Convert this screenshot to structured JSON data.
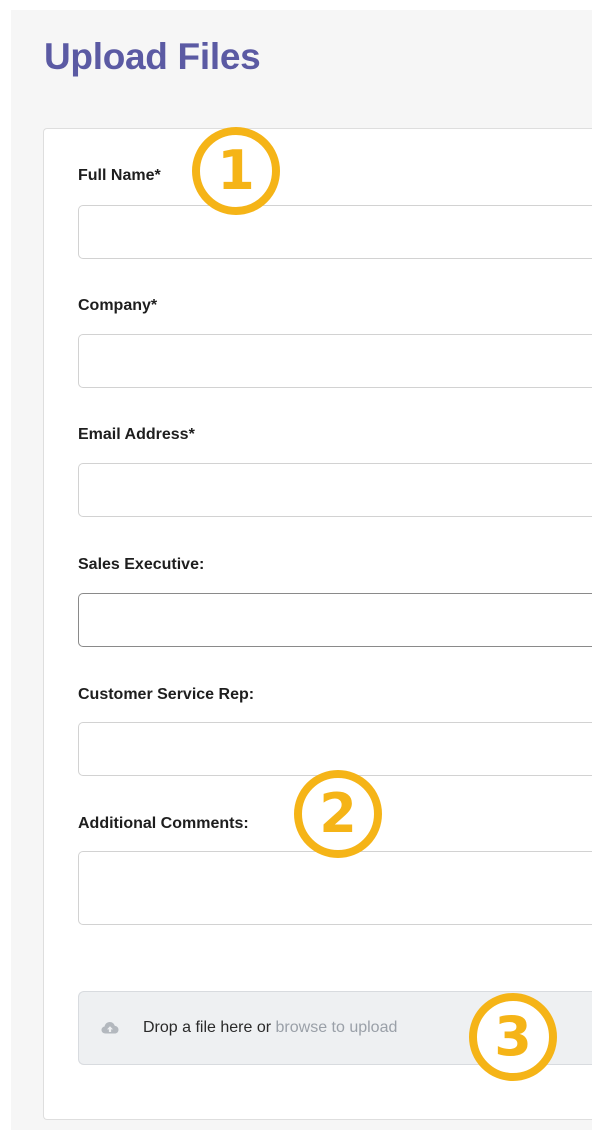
{
  "page": {
    "title": "Upload Files"
  },
  "form": {
    "fields": [
      {
        "label": "Full Name*",
        "value": "",
        "placeholder": ""
      },
      {
        "label": "Company*",
        "value": "",
        "placeholder": ""
      },
      {
        "label": "Email Address*",
        "value": "",
        "placeholder": ""
      },
      {
        "label": "Sales Executive:",
        "value": "",
        "placeholder": ""
      },
      {
        "label": "Customer Service Rep:",
        "value": "",
        "placeholder": ""
      }
    ],
    "comments": {
      "label": "Additional Comments:",
      "value": "",
      "placeholder": ""
    },
    "upload": {
      "icon": "cloud-upload-icon",
      "prompt": "Drop a file here or",
      "browse_link": "browse to upload"
    }
  },
  "annotations": [
    {
      "number": "1",
      "color": "#f5b417"
    },
    {
      "number": "2",
      "color": "#f5b417"
    },
    {
      "number": "3",
      "color": "#f5b417"
    }
  ],
  "colors": {
    "title": "#5b5aa3",
    "page_background": "#f6f6f6",
    "card_background": "#ffffff",
    "annotation": "#f5b417",
    "link": "#9aa0a8"
  }
}
